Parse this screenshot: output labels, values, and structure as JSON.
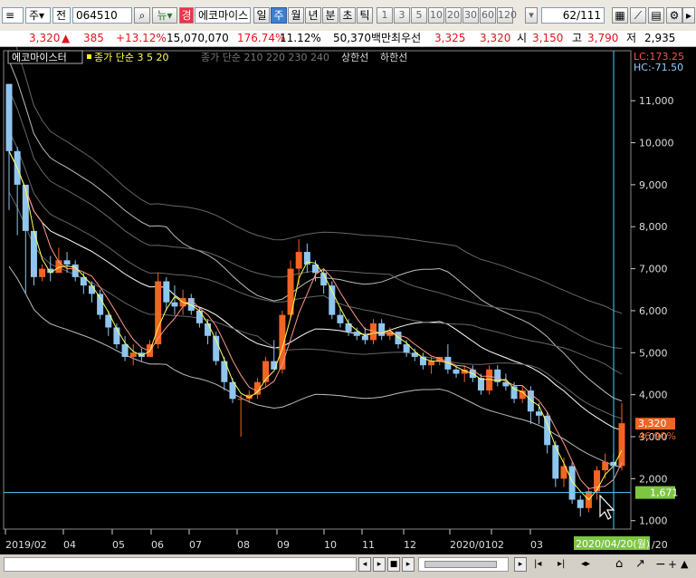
{
  "toolbar": {
    "market": "주",
    "period_sel": "전",
    "code": "064510",
    "search_icon": "search-icon",
    "news_label": "뉴",
    "stock_name": "에코마이스",
    "stock_badge": "경",
    "periods": [
      "일",
      "주",
      "월",
      "년",
      "분",
      "초",
      "틱"
    ],
    "active_period": "주",
    "intervals": [
      "1",
      "3",
      "5",
      "10",
      "20",
      "30",
      "60",
      "120"
    ],
    "page_value": "62",
    "page_total": "/111"
  },
  "quote": {
    "price": "3,320",
    "change": "385",
    "change_pct": "+13.12%",
    "volume": "15,070,070",
    "volume_pct": "176.74%",
    "turnover_pct": "11.12%",
    "amount": "50,370백만",
    "best_label": "최우선",
    "best_ask": "3,325",
    "best_bid": "3,320",
    "open_label": "시",
    "open": "3,150",
    "high_label": "고",
    "high": "3,790",
    "low_label": "저",
    "low": "2,935"
  },
  "legend": {
    "name": "에코마이스터",
    "ma_close": "종가 단순 3 5 20",
    "ma_long": "종가 단순 210 220 230 240",
    "upper": "상한선",
    "lower": "하한선"
  },
  "readout": {
    "lc": "LC:173.25",
    "hc": "HC:-71.50",
    "price_tag": "3,320",
    "pct_tag": "46.90%",
    "cursor_tag": "1,671",
    "date_tag": "2020/04/20(월)",
    "date_tail": "/20"
  },
  "colors": {
    "up": "#f26522",
    "down": "#8fc6f0",
    "ma3": "#ffff55",
    "ma5": "#ff9a8a",
    "ma20": "#ffffff",
    "cursor": "#4fd2ff",
    "price_tag_bg": "#f26522",
    "cursor_tag_bg": "#7dc640"
  },
  "chart_data": {
    "type": "candlestick",
    "y_ticks": [
      "11,000",
      "10,000",
      "9,000",
      "8,000",
      "7,000",
      "6,000",
      "5,000",
      "4,000",
      "3,000",
      "2,000",
      "1,000"
    ],
    "y_tick_values": [
      11000,
      10000,
      9000,
      8000,
      7000,
      6000,
      5000,
      4000,
      3000,
      2000,
      1000
    ],
    "ylim": [
      800,
      11500
    ],
    "x_ticks": [
      "2019/02",
      "04",
      "05",
      "06",
      "07",
      "08",
      "09",
      "10",
      "11",
      "12",
      "2020/01",
      "02",
      "03"
    ],
    "candles": [
      [
        11400,
        11400,
        8400,
        9800
      ],
      [
        9800,
        9900,
        7800,
        9000
      ],
      [
        9000,
        8400,
        6400,
        7900
      ],
      [
        7900,
        7600,
        6600,
        6800
      ],
      [
        6800,
        7100,
        6700,
        7000
      ],
      [
        7000,
        7300,
        6700,
        6900
      ],
      [
        6900,
        7500,
        6900,
        7200
      ],
      [
        7200,
        7400,
        6900,
        7100
      ],
      [
        7100,
        7200,
        6700,
        6800
      ],
      [
        6800,
        6900,
        6400,
        6600
      ],
      [
        6600,
        6700,
        6200,
        6400
      ],
      [
        6400,
        6500,
        5800,
        5900
      ],
      [
        5900,
        6000,
        5400,
        5600
      ],
      [
        5600,
        5700,
        5100,
        5200
      ],
      [
        5200,
        5400,
        4800,
        4900
      ],
      [
        4900,
        5200,
        4700,
        5000
      ],
      [
        5000,
        5100,
        4800,
        4900
      ],
      [
        4900,
        5300,
        4900,
        5200
      ],
      [
        5200,
        6900,
        5100,
        6700
      ],
      [
        6700,
        6800,
        6000,
        6200
      ],
      [
        6200,
        6600,
        5900,
        6100
      ],
      [
        6100,
        6500,
        5900,
        6300
      ],
      [
        6300,
        6400,
        5900,
        6000
      ],
      [
        6000,
        6100,
        5600,
        5700
      ],
      [
        5700,
        5800,
        5200,
        5400
      ],
      [
        5400,
        5500,
        4700,
        4800
      ],
      [
        4800,
        4900,
        4100,
        4300
      ],
      [
        4300,
        4400,
        3800,
        3900
      ],
      [
        3900,
        4000,
        3000,
        3900
      ],
      [
        3900,
        4100,
        3800,
        4000
      ],
      [
        4000,
        4400,
        3900,
        4300
      ],
      [
        4300,
        4900,
        4200,
        4800
      ],
      [
        4800,
        5300,
        4600,
        4600
      ],
      [
        4600,
        6000,
        4500,
        5900
      ],
      [
        5900,
        7200,
        5800,
        7000
      ],
      [
        7000,
        7700,
        6600,
        7400
      ],
      [
        7400,
        7600,
        6900,
        7100
      ],
      [
        7100,
        7200,
        6700,
        6900
      ],
      [
        6900,
        7000,
        6400,
        6600
      ],
      [
        6600,
        6700,
        5800,
        5900
      ],
      [
        5900,
        6100,
        5600,
        5700
      ],
      [
        5700,
        5800,
        5400,
        5500
      ],
      [
        5500,
        5600,
        5300,
        5400
      ],
      [
        5400,
        5600,
        5200,
        5300
      ],
      [
        5300,
        5800,
        5200,
        5700
      ],
      [
        5700,
        5800,
        5300,
        5400
      ],
      [
        5400,
        5600,
        5300,
        5500
      ],
      [
        5500,
        5500,
        5100,
        5200
      ],
      [
        5200,
        5300,
        4900,
        5000
      ],
      [
        5000,
        5100,
        4800,
        4900
      ],
      [
        4900,
        5000,
        4600,
        4700
      ],
      [
        4700,
        4900,
        4500,
        4800
      ],
      [
        4800,
        4900,
        4700,
        4900
      ],
      [
        4900,
        5200,
        4500,
        4600
      ],
      [
        4600,
        4700,
        4400,
        4500
      ],
      [
        4500,
        4700,
        4300,
        4600
      ],
      [
        4600,
        4700,
        4300,
        4400
      ],
      [
        4400,
        4500,
        4000,
        4100
      ],
      [
        4100,
        4700,
        4000,
        4600
      ],
      [
        4600,
        4700,
        4200,
        4300
      ],
      [
        4300,
        4500,
        4100,
        4200
      ],
      [
        4200,
        4300,
        3800,
        3900
      ],
      [
        3900,
        4200,
        3800,
        4100
      ],
      [
        4100,
        4200,
        3300,
        3600
      ],
      [
        3600,
        3800,
        3300,
        3500
      ],
      [
        3500,
        3600,
        2600,
        2800
      ],
      [
        2800,
        2900,
        1800,
        2000
      ],
      [
        2000,
        2500,
        1800,
        2300
      ],
      [
        2300,
        2400,
        1400,
        1500
      ],
      [
        1500,
        1600,
        1100,
        1300
      ],
      [
        1300,
        1800,
        1200,
        1700
      ],
      [
        1700,
        2300,
        1500,
        2200
      ],
      [
        2200,
        2600,
        2000,
        2400
      ],
      [
        2400,
        2600,
        2100,
        2300
      ],
      [
        2300,
        3800,
        2200,
        3320
      ]
    ]
  }
}
